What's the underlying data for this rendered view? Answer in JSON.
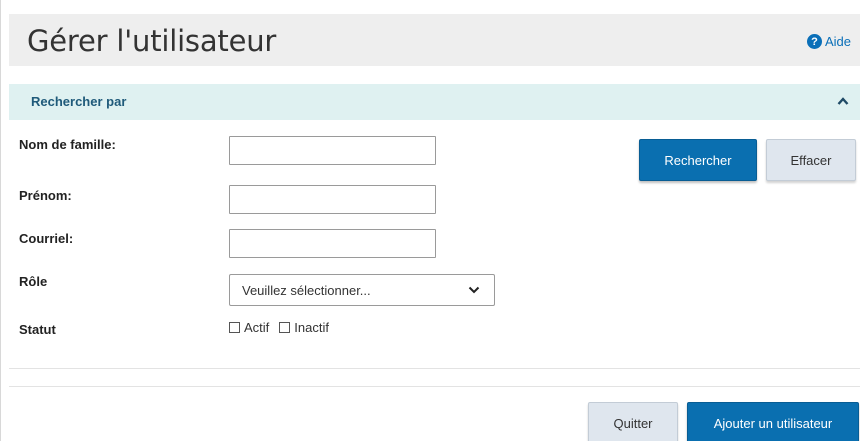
{
  "header": {
    "title": "Gérer l'utilisateur",
    "help_label": "Aide",
    "help_icon": "question-circle-icon"
  },
  "search_section": {
    "title": "Rechercher par",
    "collapse_icon": "chevron-up-icon"
  },
  "form": {
    "last_name_label": "Nom de famille:",
    "last_name_value": "",
    "first_name_label": "Prénom:",
    "first_name_value": "",
    "email_label": "Courriel:",
    "email_value": "",
    "role_label": "Rôle",
    "role_selected": "Veuillez sélectionner...",
    "status_label": "Statut",
    "status_active_label": "Actif",
    "status_inactive_label": "Inactif"
  },
  "actions": {
    "search_label": "Rechercher",
    "clear_label": "Effacer",
    "quit_label": "Quitter",
    "add_user_label": "Ajouter un utilisateur"
  },
  "colors": {
    "primary": "#0a6fb0",
    "section_bg": "#dff1f1",
    "header_bg": "#eeeeee"
  }
}
